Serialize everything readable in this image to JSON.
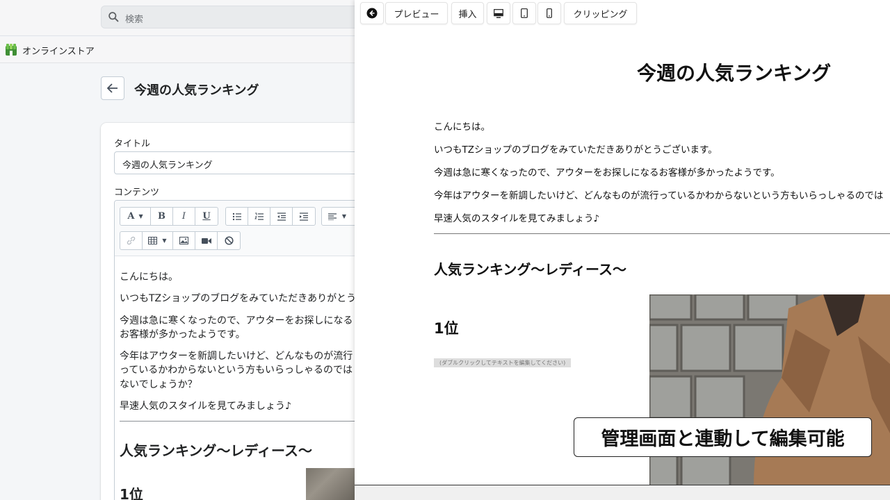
{
  "search": {
    "placeholder": "検索"
  },
  "store": {
    "name": "オンラインストア"
  },
  "page": {
    "title": "今週の人気ランキング"
  },
  "form": {
    "title_label": "タイトル",
    "title_value": "今週の人気ランキング",
    "content_label": "コンテンツ"
  },
  "editor_toolbar": {
    "font_button": "A",
    "bold": "B",
    "italic": "I",
    "underline": "U"
  },
  "editor_content": {
    "p1": "こんにちは。",
    "p2": "いつもTZショップのブログをみていただきありがとうございます。",
    "p3": "今週は急に寒くなったので、アウターをお探しになるお客様が多かったようです。",
    "p4": "今年はアウターを新調したいけど、どんなものが流行っているかわからないという方もいらっしゃるのではないでしょうか？",
    "p5": "早速人気のスタイルを見てみましょう♪",
    "heading": "人気ランキング〜レディース〜",
    "rank": "1位"
  },
  "preview_toolbar": {
    "preview": "プレビュー",
    "insert": "挿入",
    "clipping": "クリッピング"
  },
  "preview_content": {
    "title": "今週の人気ランキング",
    "p1": "こんにちは。",
    "p2": "いつもTZショップのブログをみていただきありがとうございます。",
    "p3": "今週は急に寒くなったので、アウターをお探しになるお客様が多かったようです。",
    "p4": "今年はアウターを新調したいけど、どんなものが流行っているかわからないという方もいらっしゃるのでは",
    "p5": "早速人気のスタイルを見てみましょう♪",
    "heading": "人気ランキング〜レディース〜",
    "rank": "1位",
    "placeholder": "(ダブルクリックしてテキストを編集してください)"
  },
  "caption": "管理画面と連動して編集可能",
  "colors": {
    "admin_bg": "#f4f6f8",
    "logo_green": "#3f8f35",
    "coat": "#a67a55"
  }
}
